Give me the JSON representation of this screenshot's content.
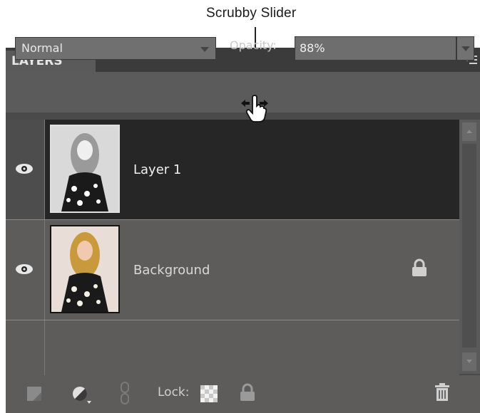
{
  "annotation": {
    "callout": "Scrubby Slider"
  },
  "panel": {
    "tab_title": "LAYERS",
    "menu_icon": "panel-menu-icon"
  },
  "options": {
    "blend_mode": "Normal",
    "opacity_label": "Opacity:",
    "opacity_value": "88%"
  },
  "layers": [
    {
      "name": "Layer 1",
      "selected": true,
      "visible": true,
      "locked": false
    },
    {
      "name": "Background",
      "selected": false,
      "visible": true,
      "locked": true
    }
  ],
  "toolbar": {
    "new_layer_icon": "new-layer-icon",
    "adjustment_icon": "adjustment-layer-icon",
    "link_icon": "link-icon",
    "lock_label": "Lock:",
    "lock_transparent_icon": "lock-transparent-icon",
    "lock_all_icon": "lock-all-icon",
    "delete_icon": "trash-icon"
  },
  "colors": {
    "panel_bg": "#4a4a4a",
    "selected_row": "#262626",
    "row_bg": "#5e5b5b"
  }
}
